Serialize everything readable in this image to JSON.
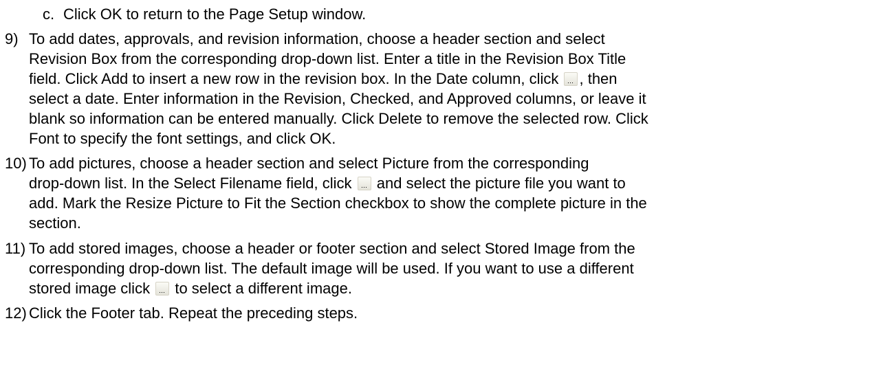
{
  "step_c": {
    "label": "c.",
    "text": "Click OK to return to the Page Setup window."
  },
  "step9": {
    "number": "9)",
    "line1": "To add dates, approvals, and revision information, choose a header section and select",
    "line2": "Revision Box from the corresponding drop-down list. Enter a title in the Revision Box Title",
    "line3_before": "field. Click Add to insert a new row in the revision box. In the Date column, click",
    "line3_after": ", then",
    "line4": "select a date. Enter information in the Revision, Checked, and Approved columns, or leave it",
    "line5": "blank so information can be entered manually. Click Delete to remove the selected row. Click",
    "line6": "Font to specify the font settings, and click OK."
  },
  "step10": {
    "number": "10)",
    "line1": "To add pictures, choose a header section and select Picture from the corresponding",
    "line2_before": "drop-down list. In the Select Filename field, click",
    "line2_after": "and select the picture file you want to",
    "line3": "add. Mark the Resize Picture to Fit the Section checkbox to show the complete picture in the",
    "line4": "section."
  },
  "step11": {
    "number": "11)",
    "line1": "To add stored images, choose a header or footer section and select Stored Image from the",
    "line2": "corresponding drop-down list. The default image will be used. If you want to use a different",
    "line3_before": "stored image click",
    "line3_after": "to select a different image."
  },
  "step12": {
    "number": "12)",
    "line1": "Click the Footer tab. Repeat the preceding steps."
  },
  "icons": {
    "browse": "ellipsis-browse-icon"
  }
}
